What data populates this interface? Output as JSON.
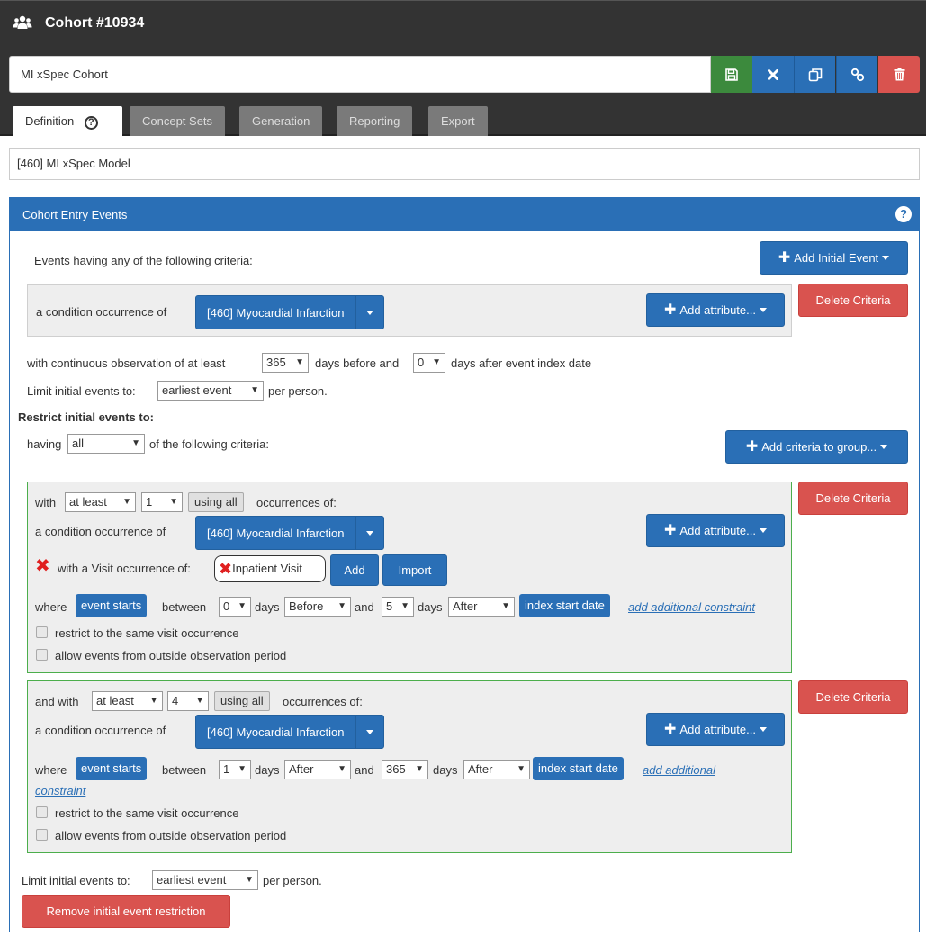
{
  "header": {
    "title": "Cohort #10934",
    "icon": "users-icon"
  },
  "cohort_name": "MI xSpec Cohort",
  "toolbar": {
    "save": "save-icon",
    "close": "close-icon",
    "copy": "copy-icon",
    "link": "link-icon",
    "delete": "trash-icon"
  },
  "tabs": [
    {
      "label": "Definition"
    },
    {
      "label": "Concept Sets"
    },
    {
      "label": "Generation"
    },
    {
      "label": "Reporting"
    },
    {
      "label": "Export"
    }
  ],
  "model_name": "[460] MI xSpec Model",
  "entry": {
    "title": "Cohort Entry Events",
    "help": "?",
    "events_having": "Events having any of the following criteria:",
    "add_initial_event": "Add Initial Event",
    "delete_criteria": "Delete Criteria",
    "condition_of": "a condition occurrence of",
    "concept": "[460] Myocardial Infarction",
    "add_attribute": "Add attribute...",
    "obs_prefix": "with continuous observation of at least",
    "obs_before_val": "365",
    "obs_mid": "days before and",
    "obs_after_val": "0",
    "obs_suffix": "days after event index date",
    "limit_prefix": "Limit initial events to:",
    "limit_value": "earliest event",
    "limit_suffix": "per person."
  },
  "restrict": {
    "title": "Restrict initial events to:",
    "having": "having",
    "having_value": "all",
    "of_following": "of the following criteria:",
    "add_criteria": "Add criteria to group...",
    "c1": {
      "with": "with",
      "qualifier": "at least",
      "count": "1",
      "using_all": "using all",
      "occ_of": "occurrences of:",
      "condition_of": "a condition occurrence of",
      "concept": "[460] Myocardial Infarction",
      "add_attribute": "Add attribute...",
      "delete": "Delete Criteria",
      "visit_label": "with a Visit occurrence of:",
      "visit_value": "Inpatient Visit",
      "add": "Add",
      "import": "Import",
      "where": "where",
      "event_starts": "event starts",
      "between": "between",
      "v1": "0",
      "days1": "days",
      "rel1": "Before",
      "and": "and",
      "v2": "5",
      "days2": "days",
      "rel2": "After",
      "index_start": "index start date",
      "add_constraint": "add additional constraint",
      "restrict_visit": "restrict to the same visit occurrence",
      "allow_outside": "allow events from outside observation period"
    },
    "c2": {
      "with": "and with",
      "qualifier": "at least",
      "count": "4",
      "using_all": "using all",
      "occ_of": "occurrences of:",
      "condition_of": "a condition occurrence of",
      "concept": "[460] Myocardial Infarction",
      "add_attribute": "Add attribute...",
      "delete": "Delete Criteria",
      "where": "where",
      "event_starts": "event starts",
      "between": "between",
      "v1": "1",
      "days1": "days",
      "rel1": "After",
      "and": "and",
      "v2": "365",
      "days2": "days",
      "rel2": "After",
      "index_start": "index start date",
      "add_constraint_1": "add additional",
      "add_constraint_2": "constraint",
      "restrict_visit": "restrict to the same visit occurrence",
      "allow_outside": "allow events from outside observation period"
    }
  },
  "footer": {
    "limit_prefix": "Limit initial events to:",
    "limit_value": "earliest event",
    "limit_suffix": "per person.",
    "remove_restriction": "Remove initial event restriction"
  },
  "colors": {
    "header_bg": "#333333",
    "primary": "#2a6fb6",
    "danger": "#d9534f",
    "success": "#3c8a3d",
    "group_border": "#4cae4c"
  }
}
